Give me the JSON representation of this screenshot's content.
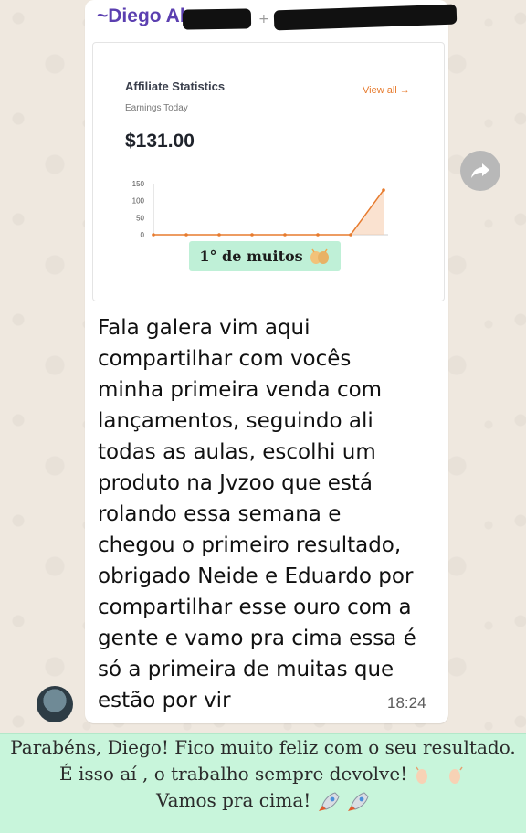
{
  "message": {
    "sender": "~Diego Abreu",
    "body": "Fala galera vim aqui\ncompartilhar com vocês\nminha primeira venda com\nlançamentos, seguindo ali\ntodas as aulas, escolhi um\nproduto na Jvzoo que está\nrolando essa semana e\nchegou o primeiro resultado,\nobrigado Neide e Eduardo por\ncompartilhar esse ouro com a\ngente e vamo pra cima essa é\nsó a primeira de muitas que\nestão por vir",
    "time": "18:24"
  },
  "card": {
    "title": "Affiliate Statistics",
    "subtitle": "Earnings Today",
    "value": "$131.00",
    "view_all": "View all →",
    "caption": "1° de muitos"
  },
  "chart_data": {
    "type": "area",
    "ylabel": "",
    "xlabel": "",
    "yticks": [
      "150",
      "100",
      "50",
      "0"
    ],
    "ylim": [
      0,
      150
    ],
    "series": [
      {
        "values": [
          0,
          0,
          0,
          0,
          0,
          0,
          0,
          131
        ]
      }
    ],
    "color": "#e77b2e"
  },
  "reply": {
    "line1": "Parabéns, Diego! Fico muito feliz com o seu resultado.",
    "line2": "É isso aí , o trabalho sempre devolve!",
    "line3": "Vamos pra cima!"
  },
  "icons": {
    "share": "share-forward-icon",
    "clap": "clapping-hands-icon",
    "rocket": "rocket-icon"
  },
  "colors": {
    "sender": "#5b3fb0",
    "accent": "#e77b2e",
    "caption_bg": "#bff0d7",
    "reply_bg": "#c8f5db"
  }
}
